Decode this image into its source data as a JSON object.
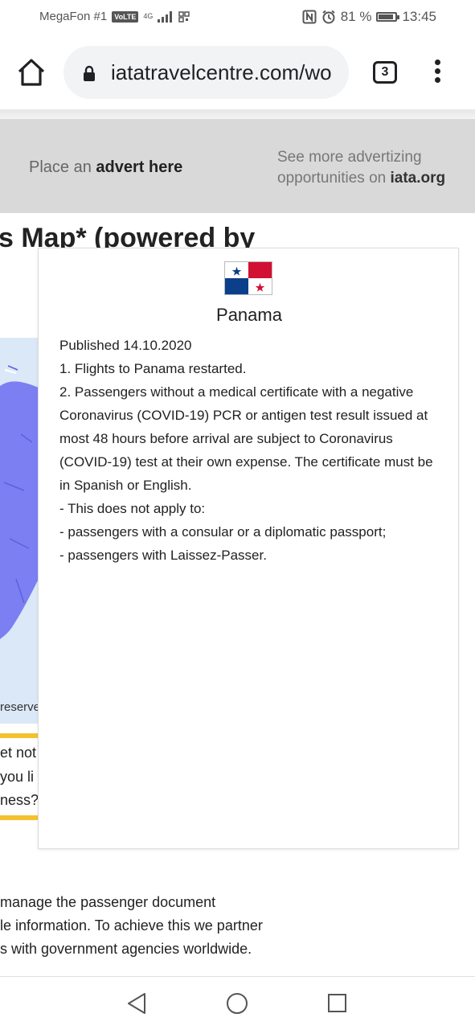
{
  "status_bar": {
    "carrier": "MegaFon #1",
    "volte": "VoLTE",
    "network": "4G",
    "battery": "81 %",
    "battery_level": 0.81,
    "time": "13:45"
  },
  "browser": {
    "url": "iatatravelcentre.com/wo",
    "tab_count": "3",
    "icons": [
      "home-icon",
      "lock-icon",
      "tab-switcher-icon",
      "more-vert-icon"
    ]
  },
  "advert": {
    "left_prefix": "Place an ",
    "left_bold": "advert here",
    "right_line1": "See more advertizing",
    "right_line2_prefix": "opportunities on ",
    "right_line2_bold": "iata.org"
  },
  "page": {
    "heading_fragment": "s Map* (powered by",
    "map_copyright_fragment": "reserve",
    "callout_lines": [
      "et not",
      " you li",
      "ness?"
    ],
    "bottom_lines": [
      " manage the passenger document",
      "le information. To achieve this we partner",
      "s with government agencies worldwide."
    ]
  },
  "popup": {
    "country": "Panama",
    "published": "Published 14.10.2020",
    "lines": [
      "1. Flights to Panama restarted.",
      "2. Passengers without a medical certificate with a negative Coronavirus (COVID-19) PCR or antigen test result issued at most 48 hours before arrival are subject to Coronavirus (COVID-19) test at their own expense. The certificate must be in Spanish or English.",
      "- This does not apply to:",
      "- passengers with a consular or a diplomatic passport;",
      "- passengers with Laissez-Passer."
    ],
    "flag_colors": {
      "blue": "#0b3f8a",
      "red": "#d21034",
      "white": "#ffffff"
    }
  },
  "nav_bar": {
    "icons": [
      "back-icon",
      "home-circle-icon",
      "recents-icon"
    ]
  }
}
